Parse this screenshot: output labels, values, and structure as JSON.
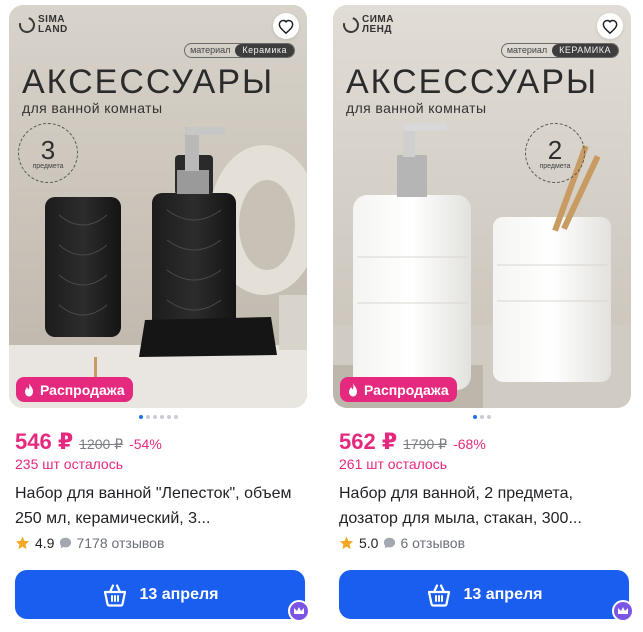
{
  "products": [
    {
      "brand": "SIMA\nLAND",
      "material_label": "материал",
      "material_value": "Керамика",
      "headline": "АКСЕССУАРЫ",
      "subheadline": "для ванной комнаты",
      "count_number": "3",
      "count_word": "предмета",
      "sale_label": "Распродажа",
      "price": "546 ₽",
      "old_price": "1200 ₽",
      "discount": "-54%",
      "stock": "235 шт осталось",
      "title": "Набор для ванной \"Лепесток\", объем 250 мл, керамический, 3...",
      "rating": "4.9",
      "reviews": "7178 отзывов",
      "delivery": "13 апреля",
      "dots": 6,
      "active_dot": 1
    },
    {
      "brand": "СИМА\nЛЕНД",
      "material_label": "материал",
      "material_value": "КЕРАМИКА",
      "headline": "АКСЕССУАРЫ",
      "subheadline": "для ванной комнаты",
      "count_number": "2",
      "count_word": "предмета",
      "sale_label": "Распродажа",
      "price": "562 ₽",
      "old_price": "1790 ₽",
      "discount": "-68%",
      "stock": "261 шт осталось",
      "title": "Набор для ванной, 2 предмета, дозатор для мыла, стакан, 300...",
      "rating": "5.0",
      "reviews": "6 отзывов",
      "delivery": "13 апреля",
      "dots": 3,
      "active_dot": 1
    }
  ],
  "colors": {
    "accent_pink": "#e5297f",
    "button_blue": "#1a5ef0",
    "star": "#f5a623",
    "crown": "#7c55e6"
  }
}
